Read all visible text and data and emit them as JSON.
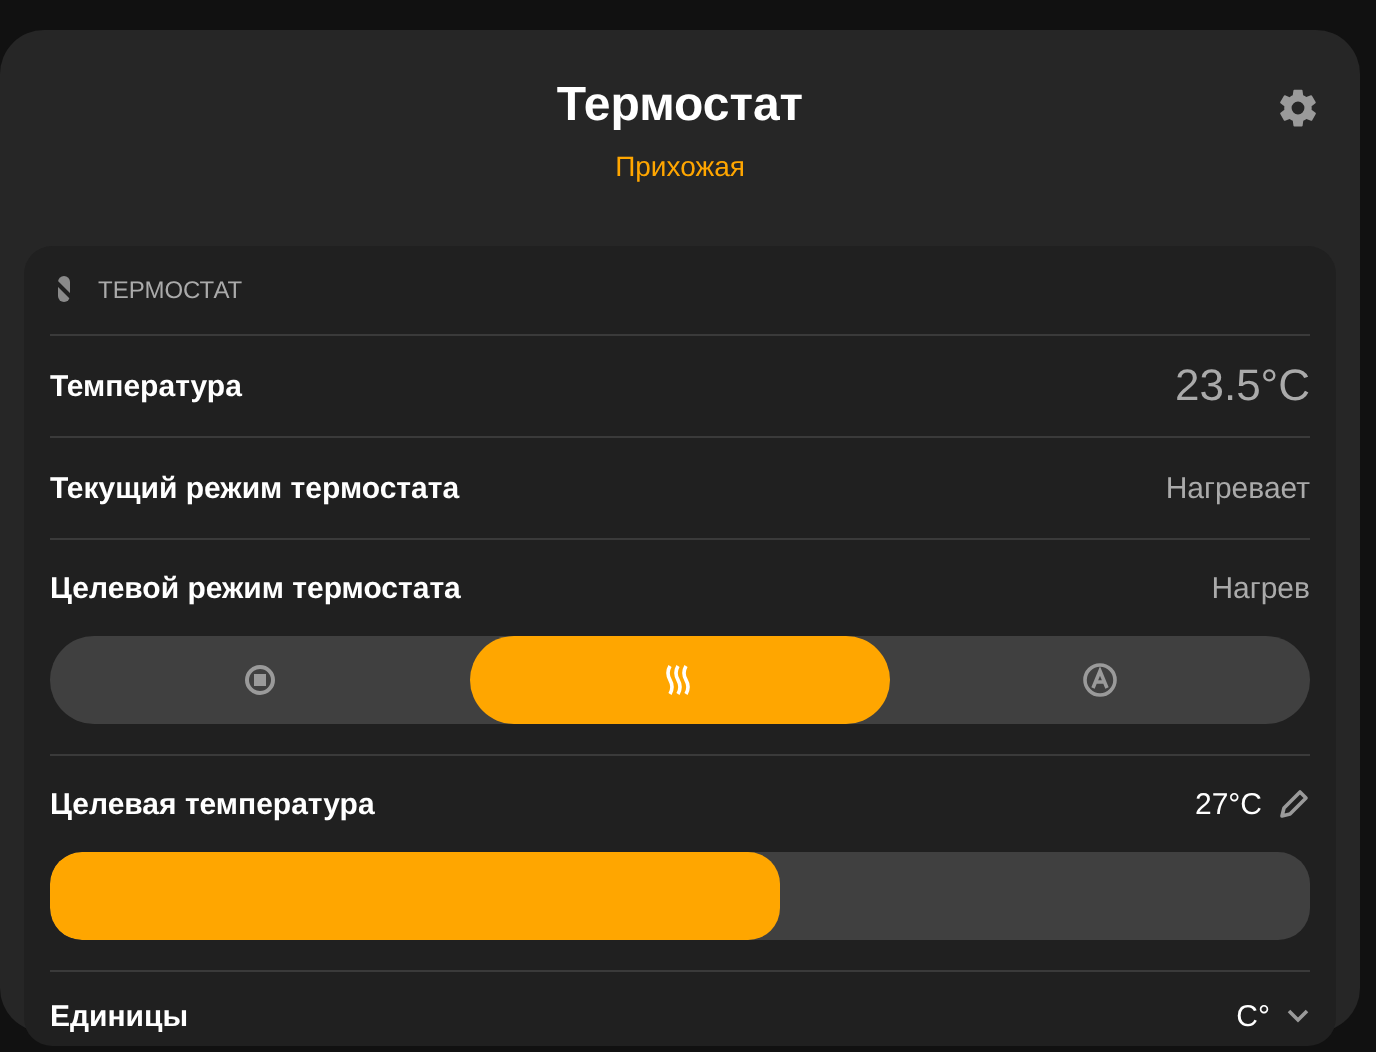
{
  "header": {
    "title": "Термостат",
    "subtitle": "Прихожая"
  },
  "section": {
    "title": "ТЕРМОСТАТ"
  },
  "rows": [
    {
      "kind": "reading",
      "label": "Температура",
      "value": "23.5°C"
    },
    {
      "kind": "text",
      "label": "Текущий режим термостата",
      "value": "Нагревает"
    },
    {
      "kind": "modes",
      "label": "Целевой режим термостата",
      "value": "Нагрев",
      "modes": [
        {
          "kind": "off",
          "selected": false
        },
        {
          "kind": "heat",
          "selected": true
        },
        {
          "kind": "auto",
          "selected": false
        }
      ]
    },
    {
      "kind": "slider",
      "label": "Целевая температура",
      "value": "27°C",
      "level": 0.58
    },
    {
      "kind": "select",
      "label": "Единицы",
      "value": "C°"
    }
  ]
}
